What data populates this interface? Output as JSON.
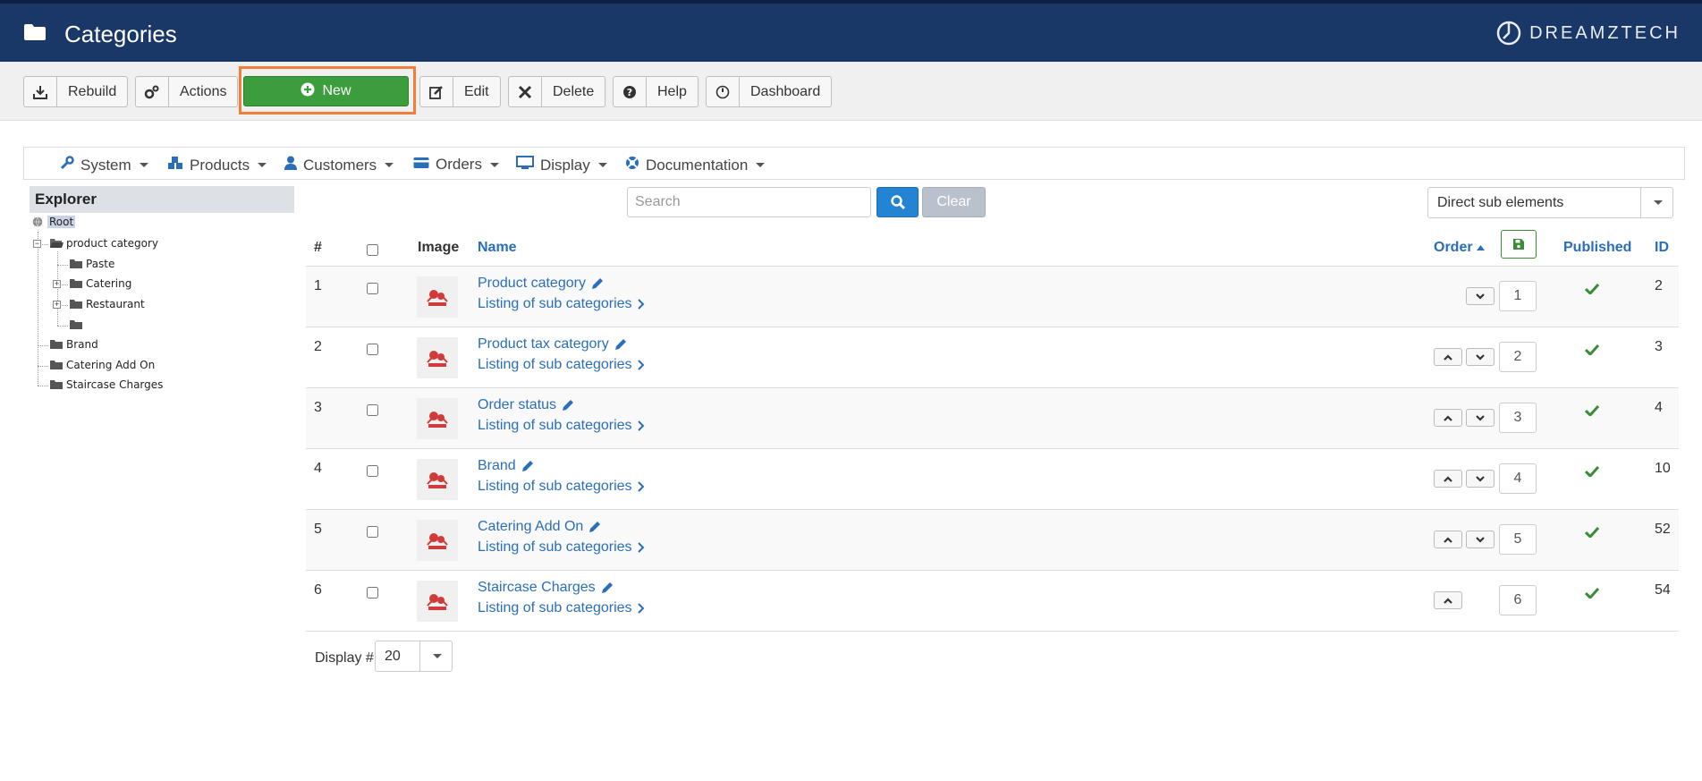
{
  "header": {
    "title": "Categories",
    "brand": "DREAMZTECH"
  },
  "toolbar": {
    "rebuild": "Rebuild",
    "actions": "Actions",
    "new": "New",
    "edit": "Edit",
    "delete": "Delete",
    "help": "Help",
    "dashboard": "Dashboard"
  },
  "menu": {
    "system": "System",
    "products": "Products",
    "customers": "Customers",
    "orders": "Orders",
    "display": "Display",
    "documentation": "Documentation"
  },
  "explorer": {
    "title": "Explorer",
    "root": "Root",
    "product_category": "product category",
    "paste": "Paste",
    "catering": "Catering",
    "restaurant": "Restaurant",
    "brand": "Brand",
    "catering_add_on": "Catering Add On",
    "staircase_charges": "Staircase Charges"
  },
  "search": {
    "placeholder": "Search",
    "clear": "Clear"
  },
  "filter": {
    "selected": "Direct sub elements"
  },
  "table": {
    "columns": {
      "num": "#",
      "image": "Image",
      "name": "Name",
      "order": "Order",
      "published": "Published",
      "id": "ID"
    },
    "sub_link": "Listing of sub categories",
    "rows": [
      {
        "num": "1",
        "name": "Product category",
        "order": "1",
        "id": "2",
        "up": false,
        "down": true,
        "published": true
      },
      {
        "num": "2",
        "name": "Product tax category",
        "order": "2",
        "id": "3",
        "up": true,
        "down": true,
        "published": true
      },
      {
        "num": "3",
        "name": "Order status",
        "order": "3",
        "id": "4",
        "up": true,
        "down": true,
        "published": true
      },
      {
        "num": "4",
        "name": "Brand",
        "order": "4",
        "id": "10",
        "up": true,
        "down": true,
        "published": true
      },
      {
        "num": "5",
        "name": "Catering Add On",
        "order": "5",
        "id": "52",
        "up": true,
        "down": true,
        "published": true
      },
      {
        "num": "6",
        "name": "Staircase Charges",
        "order": "6",
        "id": "54",
        "up": true,
        "down": false,
        "published": true
      }
    ]
  },
  "pagination": {
    "label": "Display #",
    "value": "20"
  },
  "colors": {
    "header": "#1a3867",
    "accent": "#2a6ebb",
    "new_button": "#3c9d3c",
    "highlight": "#f07f3c",
    "published": "#3a8a3a"
  }
}
